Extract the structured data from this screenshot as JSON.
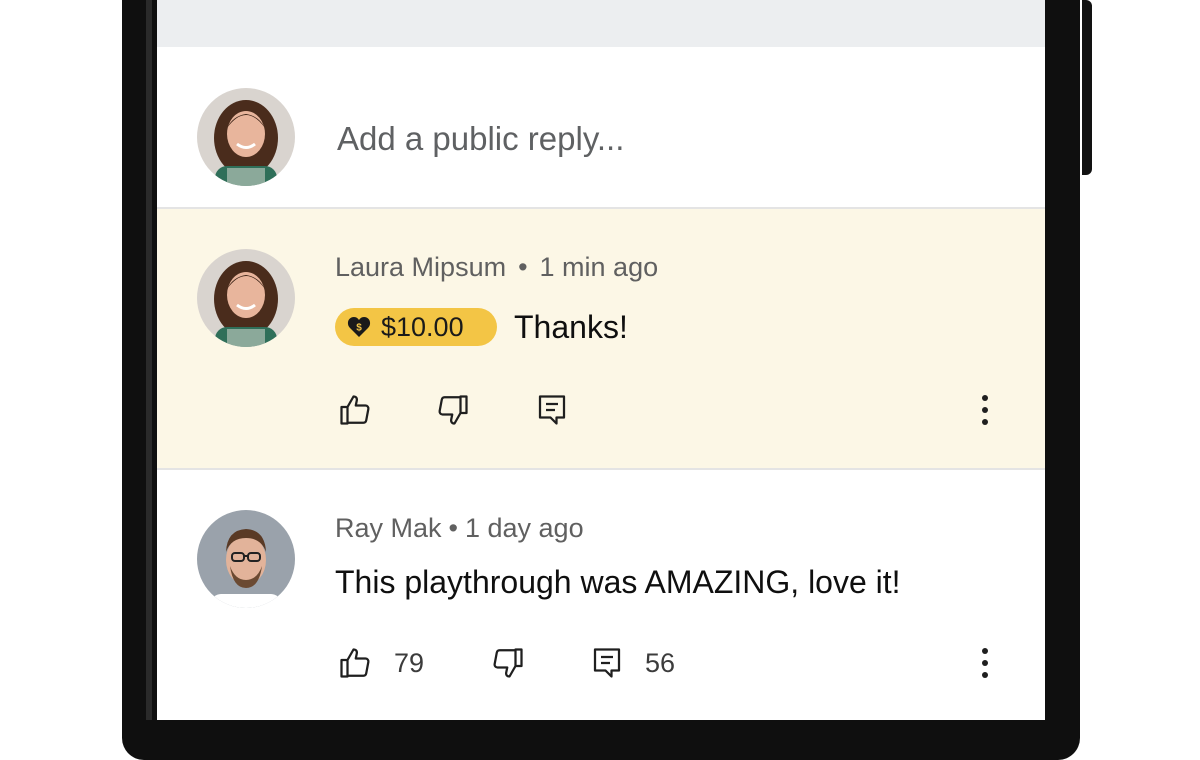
{
  "reply": {
    "placeholder": "Add a public reply..."
  },
  "comments": [
    {
      "author": "Laura Mipsum",
      "separator": "•",
      "time": "1 min ago",
      "super_thanks_amount": "$10.00",
      "text": "Thanks!",
      "highlighted": true,
      "likes": "",
      "replies": ""
    },
    {
      "author": "Ray Mak",
      "separator": "•",
      "time": "1 day ago",
      "text": "This playthrough was AMAZING, love it!",
      "highlighted": false,
      "likes": "79",
      "replies": "56"
    }
  ],
  "icons": {
    "like": "thumb-up-icon",
    "dislike": "thumb-down-icon",
    "reply": "reply-icon",
    "more": "more-vert-icon",
    "super_thanks": "heart-dollar-icon"
  },
  "colors": {
    "highlight_bg": "#fcf7e6",
    "chip_bg": "#f3c545",
    "meta_text": "#606060",
    "body_text": "#0f0f0f"
  }
}
